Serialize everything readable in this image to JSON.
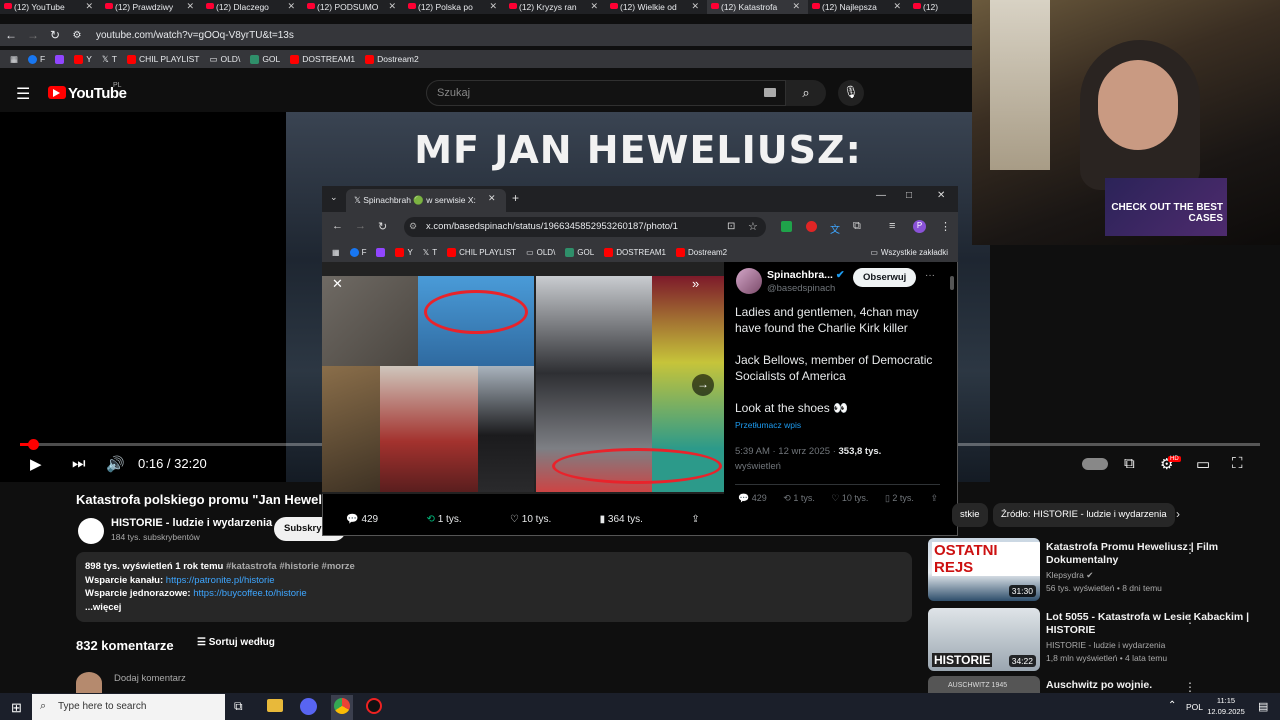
{
  "browser": {
    "tabs": [
      {
        "label": "(12) YouTube"
      },
      {
        "label": "(12) Prawdziwy"
      },
      {
        "label": "(12) Dlaczego"
      },
      {
        "label": "(12) PODSUMO"
      },
      {
        "label": "(12) Polska po"
      },
      {
        "label": "(12) Kryzys ran"
      },
      {
        "label": "(12) Wielkie od"
      },
      {
        "label": "(12) Katastrofa"
      },
      {
        "label": "(12) Najlepsza"
      },
      {
        "label": "(12)"
      }
    ],
    "url": "youtube.com/watch?v=gOOq-V8yrTU&t=13s",
    "bookmarks": [
      "F",
      "Y",
      "T",
      "CHIL PLAYLIST",
      "OLD\\",
      "GOL",
      "DOSTREAM1",
      "Dostream2"
    ]
  },
  "youtube": {
    "logo": "YouTube",
    "region": "PL",
    "search_placeholder": "Szukaj",
    "video_title_overlay": "MF JAN HEWELIUSZ:",
    "time_current": "0:16",
    "time_sep": " / ",
    "time_total": "32:20",
    "progress": 0.008,
    "video_title": "Katastrofa polskiego promu \"Jan Heweliu",
    "channel": "HISTORIE - ludzie i wydarzenia",
    "subscribers": "184 tys. subskrybentów",
    "subscribe_label": "Subskrybuj",
    "description": {
      "stats": "898 tys. wyświetleń  1 rok temu",
      "tags": "#katastrofa #historie #morze",
      "support_label": "Wsparcie kanału:",
      "support_link": "https://patronite.pl/historie",
      "one_time_label": "Wsparcie jednorazowe:",
      "one_time_link": "https://buycoffee.to/historie",
      "more": "...więcej"
    },
    "comments_count": "832 komentarze",
    "sort_label": "Sortuj według",
    "add_comment": "Dodaj komentarz",
    "chips": [
      "stkie",
      "Źródło: HISTORIE - ludzie i wydarzenia"
    ],
    "side_videos": [
      {
        "thumb_text": "OSTATNI REJS",
        "duration": "31:30",
        "title": "Katastrofa Promu Heweliusz | Film Dokumentalny",
        "channel": "Klepsydra",
        "meta": "56 tys. wyświetleń • 8 dni temu"
      },
      {
        "thumb_text": "HISTORIE",
        "duration": "34:22",
        "title": "Lot 5055 - Katastrofa w Lesie Kabackim | HISTORIE",
        "channel": "HISTORIE - ludzie i wydarzenia",
        "meta": "1,8 mln wyświetleń • 4 lata temu"
      },
      {
        "thumb_text": "AUSCHWITZ 1945",
        "duration": "",
        "title": "Auschwitz po wojnie.",
        "channel": "",
        "meta": ""
      }
    ]
  },
  "overlay_window": {
    "tab_title": "Spinachbrah 🟢 w serwisie X:",
    "url": "x.com/basedspinach/status/1966345852953260187/photo/1",
    "bookmarks": [
      "F",
      "Y",
      "T",
      "CHIL PLAYLIST",
      "OLD\\",
      "GOL",
      "DOSTREAM1",
      "Dostream2",
      "Wszystkie zakładki"
    ],
    "photo_actions": {
      "replies": "429",
      "reposts": "1 tys.",
      "likes": "10 tys.",
      "views": "364 tys."
    },
    "tweet": {
      "author": "Spinachbra...",
      "handle": "@basedspinach",
      "follow": "Obserwuj",
      "p1": "Ladies and gentlemen, 4chan may have found the Charlie Kirk killer",
      "p2": "Jack Bellows, member of Democratic Socialists of America",
      "p3": "Look at the shoes 👀",
      "translate": "Przetłumacz wpis",
      "timestamp": "5:39 AM · 12 wrz 2025 · ",
      "views_count": "353,8 tys.",
      "views_label": "wyświetleń",
      "replies": "429",
      "reposts": "1 tys.",
      "likes": "10 tys.",
      "bookmarks": "2 tys."
    }
  },
  "webcam": {
    "promo": "CHECK OUT THE BEST CASES"
  },
  "taskbar": {
    "search": "Type here to search",
    "lang": "POL",
    "time": "11:15",
    "date": "12.09.2025"
  }
}
